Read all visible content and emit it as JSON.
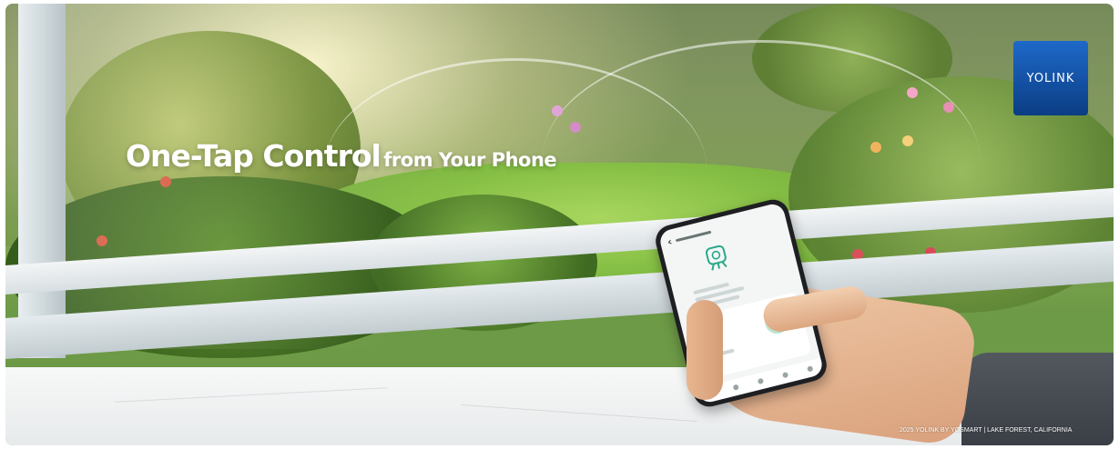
{
  "banner": {
    "headline_main": "One-Tap Control",
    "headline_sub": "from Your Phone",
    "logo_text": "YOLINK",
    "copyright": "2025 YOLINK BY YOSMART | LAKE FOREST, CALIFORNIA"
  },
  "colors": {
    "logo_top": "#1e69c9",
    "logo_bottom": "#0b3d84",
    "app_accent": "#2aa889",
    "lawn": "#86bf45"
  },
  "phone": {
    "icon": "sprinkler-timer-icon"
  }
}
